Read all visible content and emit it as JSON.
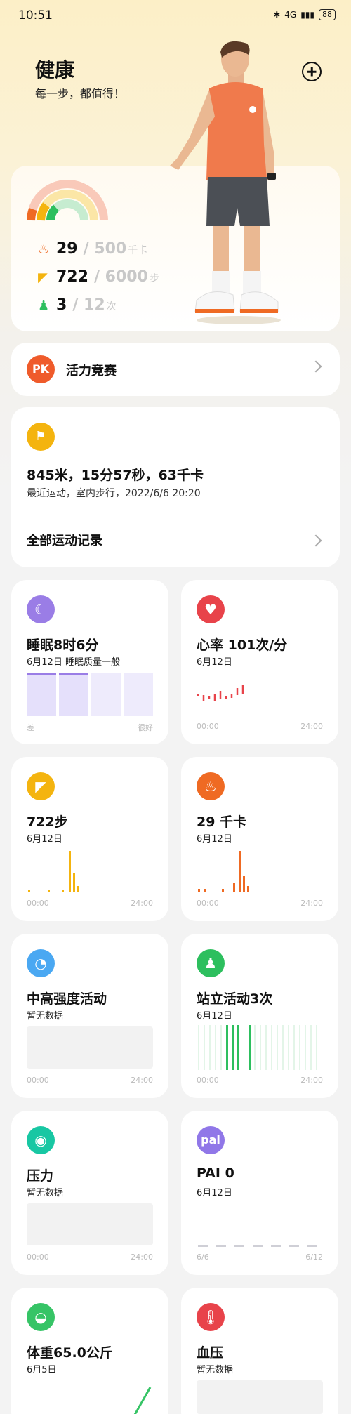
{
  "status": {
    "time": "10:51",
    "network": "4G",
    "battery": "88"
  },
  "header": {
    "title": "健康",
    "subtitle": "每一步，都值得！"
  },
  "summary": {
    "calories": {
      "value": "29",
      "goal": "/ 500",
      "unit": "千卡"
    },
    "steps": {
      "value": "722",
      "goal": "/ 6000",
      "unit": "步"
    },
    "stand": {
      "value": "3",
      "goal": "/ 12",
      "unit": "次"
    }
  },
  "pk": {
    "badge": "PK",
    "label": "活力竞赛"
  },
  "workout": {
    "main": "845米，15分57秒，63千卡",
    "sub": "最近运动，室内步行，2022/6/6 20:20",
    "all_label": "全部运动记录"
  },
  "tiles": {
    "sleep": {
      "title": "睡眠8时6分",
      "sub": "6月12日 睡眠质量一般",
      "axis_left": "差",
      "axis_right": "很好"
    },
    "heart": {
      "title": "心率 101次/分",
      "sub": "6月12日",
      "axis_left": "00:00",
      "axis_right": "24:00"
    },
    "steps": {
      "title": "722步",
      "sub": "6月12日",
      "axis_left": "00:00",
      "axis_right": "24:00"
    },
    "calories": {
      "title": "29 千卡",
      "sub": "6月12日",
      "axis_left": "00:00",
      "axis_right": "24:00"
    },
    "intensity": {
      "title": "中高强度活动",
      "sub": "暂无数据",
      "axis_left": "00:00",
      "axis_right": "24:00"
    },
    "stand": {
      "title": "站立活动3次",
      "sub": "6月12日",
      "axis_left": "00:00",
      "axis_right": "24:00"
    },
    "stress": {
      "title": "压力",
      "sub": "暂无数据",
      "axis_left": "00:00",
      "axis_right": "24:00"
    },
    "pai": {
      "badge": "pai",
      "title": "PAI 0",
      "sub": "6月12日",
      "axis_left": "6/6",
      "axis_right": "6/12"
    },
    "weight": {
      "title": "体重65.0公斤",
      "sub": "6月5日"
    },
    "bp": {
      "title": "血压",
      "sub": "暂无数据"
    }
  },
  "colors": {
    "calories": "#ef6a23",
    "steps": "#f4b40f",
    "stand": "#2dbf5e",
    "sleep": "#9a7de6",
    "heart": "#e8434a",
    "intensity": "#4aa8f2",
    "stress": "#18c7a3",
    "pai": "#9077e8",
    "weight": "#36c466",
    "bp": "#e8434a"
  }
}
